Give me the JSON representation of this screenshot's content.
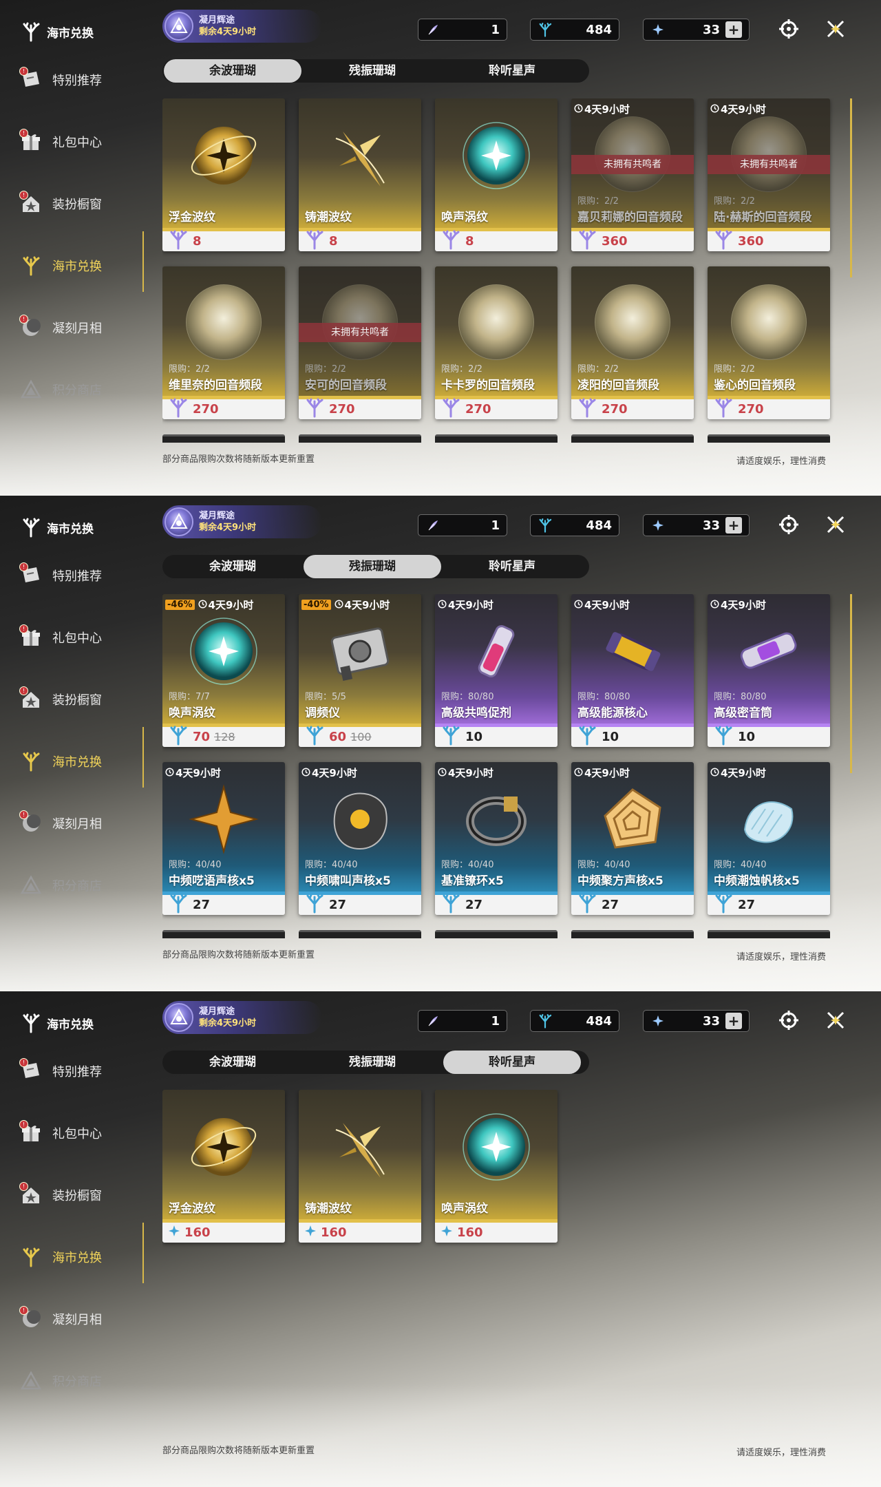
{
  "panels": [
    {
      "sidebar": {
        "title": "海市兑换",
        "items": [
          {
            "label": "特别推荐",
            "badge": "!"
          },
          {
            "label": "礼包中心",
            "badge": "!"
          },
          {
            "label": "装扮橱窗",
            "badge": "!"
          },
          {
            "label": "海市兑换",
            "badge": ""
          },
          {
            "label": "凝刻月相",
            "badge": "!"
          },
          {
            "label": "积分商店",
            "badge": ""
          }
        ]
      },
      "event": {
        "name": "凝月辉途",
        "remaining": "剩余4天9小时"
      },
      "currencies": [
        "1",
        "484",
        "33"
      ],
      "tabs": [
        "余波珊瑚",
        "残振珊瑚",
        "聆听星声"
      ],
      "active_tab": 0,
      "cards": [
        {
          "name": "浮金波纹",
          "price": "8",
          "icon": "gold-orb-icon",
          "tone": "gold"
        },
        {
          "name": "铸潮波纹",
          "price": "8",
          "icon": "gold-blade-icon",
          "tone": "gold"
        },
        {
          "name": "唤声涡纹",
          "price": "8",
          "icon": "teal-orb-icon",
          "tone": "gold"
        },
        {
          "name": "嘉贝莉娜的回音频段",
          "price": "360",
          "timer": "4天9小时",
          "limit": "限购：2/2",
          "banner": "未拥有共鸣者",
          "tone": "gold",
          "locked": true
        },
        {
          "name": "陆·赫斯的回音频段",
          "price": "360",
          "timer": "4天9小时",
          "limit": "限购：2/2",
          "banner": "未拥有共鸣者",
          "tone": "gold",
          "locked": true
        },
        {
          "name": "维里奈的回音频段",
          "price": "270",
          "limit": "限购：2/2",
          "tone": "gold"
        },
        {
          "name": "安可的回音频段",
          "price": "270",
          "limit": "限购：2/2",
          "banner": "未拥有共鸣者",
          "tone": "gold",
          "locked": true
        },
        {
          "name": "卡卡罗的回音频段",
          "price": "270",
          "limit": "限购：2/2",
          "tone": "gold"
        },
        {
          "name": "凌阳的回音频段",
          "price": "270",
          "limit": "限购：2/2",
          "tone": "gold"
        },
        {
          "name": "鉴心的回音频段",
          "price": "270",
          "limit": "限购：2/2",
          "tone": "gold"
        }
      ],
      "footer_left": "部分商品限购次数将随新版本更新重置",
      "footer_right": "请适度娱乐，理性消费"
    },
    {
      "event": {
        "name": "凝月辉途",
        "remaining": "剩余4天9小时"
      },
      "currencies": [
        "1",
        "484",
        "33"
      ],
      "cards": [
        {
          "name": "唤声涡纹",
          "price": "70",
          "old": "128",
          "discount": "-46%",
          "timer": "4天9小时",
          "limit": "限购：7/7",
          "tone": "gold"
        },
        {
          "name": "调频仪",
          "price": "60",
          "old": "100",
          "discount": "-40%",
          "timer": "4天9小时",
          "limit": "限购：5/5",
          "tone": "gold"
        },
        {
          "name": "高级共鸣促剂",
          "price": "10",
          "timer": "4天9小时",
          "limit": "限购：80/80",
          "tone": "purple"
        },
        {
          "name": "高级能源核心",
          "price": "10",
          "timer": "4天9小时",
          "limit": "限购：80/80",
          "tone": "purple"
        },
        {
          "name": "高级密音筒",
          "price": "10",
          "timer": "4天9小时",
          "limit": "限购：80/80",
          "tone": "purple"
        },
        {
          "name": "中频呓语声核x5",
          "price": "27",
          "timer": "4天9小时",
          "limit": "限购：40/40",
          "tone": "blue"
        },
        {
          "name": "中频啸叫声核x5",
          "price": "27",
          "timer": "4天9小时",
          "limit": "限购：40/40",
          "tone": "blue"
        },
        {
          "name": "基准镣环x5",
          "price": "27",
          "timer": "4天9小时",
          "limit": "限购：40/40",
          "tone": "blue"
        },
        {
          "name": "中频聚方声核x5",
          "price": "27",
          "timer": "4天9小时",
          "limit": "限购：40/40",
          "tone": "blue"
        },
        {
          "name": "中频潮蚀帆核x5",
          "price": "27",
          "timer": "4天9小时",
          "limit": "限购：40/40",
          "tone": "blue"
        }
      ],
      "footer_left": "部分商品限购次数将随新版本更新重置",
      "footer_right": "请适度娱乐，理性消费"
    },
    {
      "event": {
        "name": "凝月辉途",
        "remaining": "剩余4天9小时"
      },
      "currencies": [
        "1",
        "484",
        "33"
      ],
      "cards": [
        {
          "name": "浮金波纹",
          "price": "160",
          "tone": "gold"
        },
        {
          "name": "铸潮波纹",
          "price": "160",
          "tone": "gold"
        },
        {
          "name": "唤声涡纹",
          "price": "160",
          "tone": "gold"
        }
      ],
      "footer_left": "部分商品限购次数将随新版本更新重置",
      "footer_right": "请适度娱乐，理性消费"
    }
  ],
  "colors": {
    "accent": "#d8b849",
    "price_red": "#c8424a",
    "banner": "#8c343a",
    "discount": "#f0a01f"
  }
}
